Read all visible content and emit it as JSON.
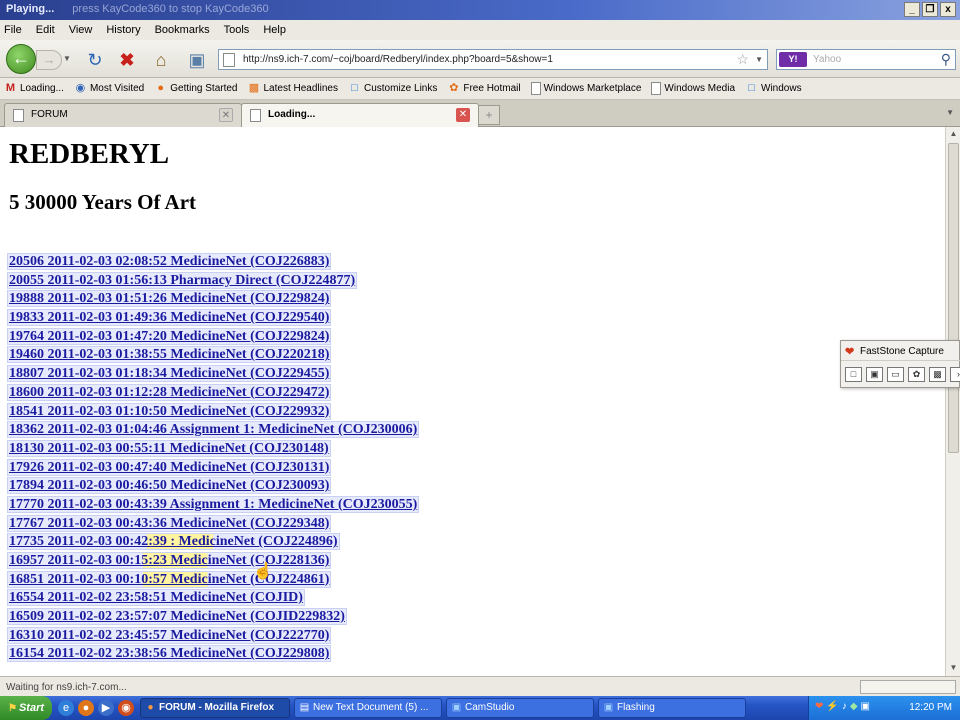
{
  "window": {
    "title": "Playing...",
    "subtitle": "press KayCode360 to stop KayCode360",
    "controls": [
      "_",
      "❐",
      "x"
    ]
  },
  "menu": [
    "File",
    "Edit",
    "View",
    "History",
    "Bookmarks",
    "Tools",
    "Help"
  ],
  "navbar": {
    "url": "http://ns9.ich-7.com/~coj/board/Redberyl/index.php?board=5&show=1",
    "search_engine": "Y!",
    "search_placeholder": "Yahoo"
  },
  "bookmarks": [
    {
      "icon": "gmail-icon",
      "label": "Loading..."
    },
    {
      "icon": "globe-icon",
      "label": "Most Visited"
    },
    {
      "icon": "firefox-icon",
      "label": "Getting Started"
    },
    {
      "icon": "rss-icon",
      "label": "Latest Headlines"
    },
    {
      "icon": "msn-icon",
      "label": "Customize Links"
    },
    {
      "icon": "msn-icon",
      "label": "Free Hotmail"
    },
    {
      "icon": "page-icon",
      "label": "Windows Marketplace"
    },
    {
      "icon": "page-icon",
      "label": "Windows Media"
    },
    {
      "icon": "msn-icon",
      "label": "Windows"
    }
  ],
  "tabs": [
    {
      "label": "FORUM",
      "active": false
    },
    {
      "label": "Loading...",
      "active": true
    }
  ],
  "page": {
    "title": "REDBERYL",
    "subtitle": "5 30000 Years Of Art",
    "threads": [
      "20506 2011-02-03 02:08:52 MedicineNet (COJ226883)",
      "20055 2011-02-03 01:56:13 Pharmacy Direct (COJ224877)",
      "19888 2011-02-03 01:51:26 MedicineNet (COJ229824)",
      "19833 2011-02-03 01:49:36 MedicineNet (COJ229540)",
      "19764 2011-02-03 01:47:20 MedicineNet (COJ229824)",
      "19460 2011-02-03 01:38:55 MedicineNet (COJ220218)",
      "18807 2011-02-03 01:18:34 MedicineNet (COJ229455)",
      "18600 2011-02-03 01:12:28 MedicineNet (COJ229472)",
      "18541 2011-02-03 01:10:50 MedicineNet (COJ229932)",
      "18362 2011-02-03 01:04:46 Assignment 1: MedicineNet (COJ230006)",
      "18130 2011-02-03 00:55:11 MedicineNet (COJ230148)",
      "17926 2011-02-03 00:47:40 MedicineNet (COJ230131)",
      "17894 2011-02-03 00:46:50 MedicineNet (COJ230093)",
      "17770 2011-02-03 00:43:39 Assignment 1: MedicineNet (COJ230055)",
      "17767 2011-02-03 00:43:36 MedicineNet (COJ229348)",
      "17735 2011-02-03 00:42:39 : MedicineNet (COJ224896)",
      "16957 2011-02-03 00:15:23 MedicineNet (COJ228136)",
      "16851 2011-02-03 00:10:57 MedicineNet (COJ224861)",
      "16554 2011-02-02 23:58:51 MedicineNet (COJID)",
      "16509 2011-02-02 23:57:07 MedicineNet (COJID229832)",
      "16310 2011-02-02 23:45:57 MedicineNet (COJ222770)",
      "16154 2011-02-02 23:38:56 MedicineNet (COJ229808)"
    ],
    "highlighted_rows": [
      15,
      16,
      17
    ]
  },
  "faststone": {
    "title": "FastStone Capture",
    "tools": [
      "window-capture-icon",
      "object-capture-icon",
      "rect-capture-icon",
      "freehand-capture-icon",
      "fullscreen-capture-icon",
      "more-icon"
    ]
  },
  "status": {
    "text": "Waiting for ns9.ich-7.com..."
  },
  "taskbar": {
    "start_label": "Start",
    "tasks": [
      {
        "label": "FORUM - Mozilla Firefox",
        "icon": "firefox-icon",
        "active": true
      },
      {
        "label": "New Text Document (5) ...",
        "icon": "notepad-icon",
        "active": false
      },
      {
        "label": "CamStudio",
        "icon": "camstudio-icon",
        "active": false
      },
      {
        "label": "Flashing",
        "icon": "flashing-icon",
        "active": false
      }
    ],
    "clock": "12:20 PM"
  }
}
